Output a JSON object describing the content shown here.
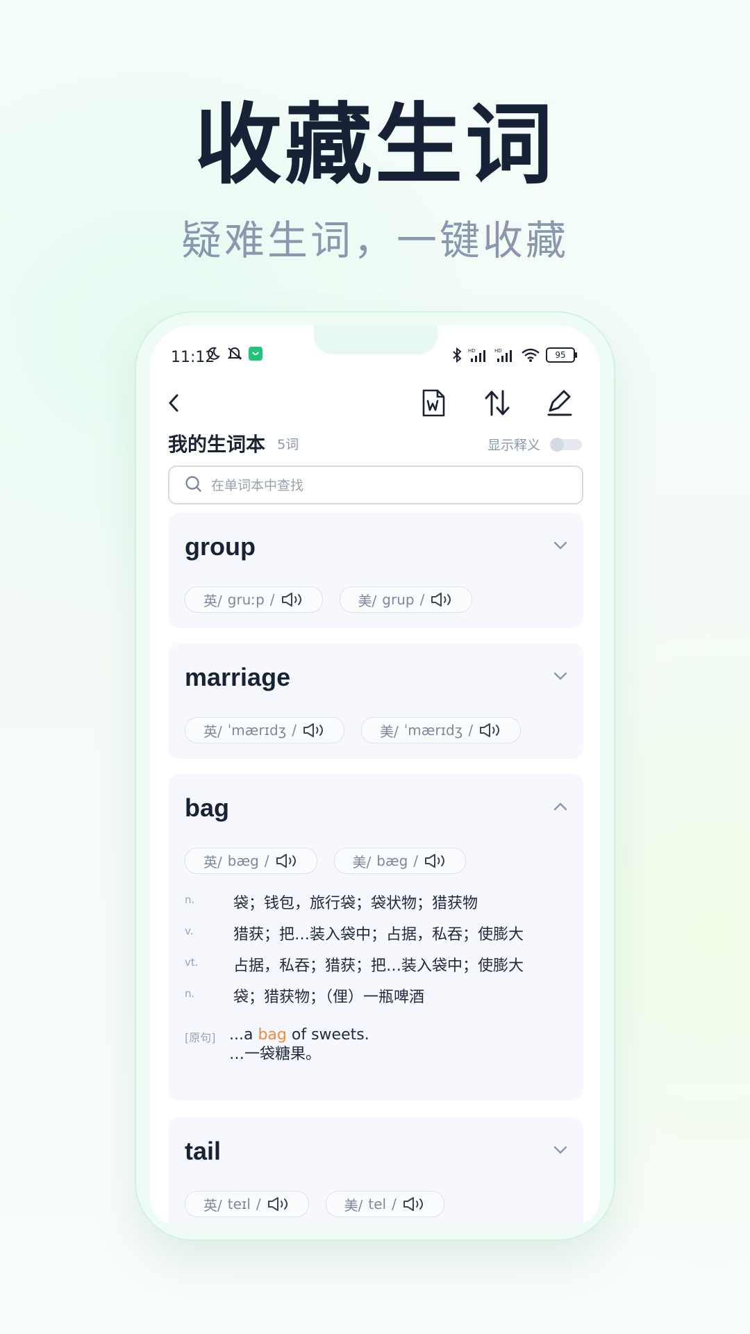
{
  "hero": {
    "title": "收藏生词",
    "subtitle": "疑难生词，一键收藏"
  },
  "status": {
    "time": "11:12",
    "battery": "95"
  },
  "header": {
    "title": "我的生词本",
    "count": "5词",
    "toggle_label": "显示释义"
  },
  "search": {
    "placeholder": "在单词本中查找"
  },
  "words": [
    {
      "word": "group",
      "uk_label": "英/",
      "uk": "gruːp",
      "us_label": "美/",
      "us": "grup",
      "slash": "/"
    },
    {
      "word": "marriage",
      "uk_label": "英/",
      "uk": "ˈmærɪdʒ",
      "us_label": "美/",
      "us": "ˈmærɪdʒ",
      "slash": "/"
    },
    {
      "word": "bag",
      "uk_label": "英/",
      "uk": "bæg",
      "us_label": "美/",
      "us": "bæg",
      "slash": "/",
      "definitions": [
        {
          "pos": "n.",
          "meaning": "袋；钱包，旅行袋；袋状物；猎获物"
        },
        {
          "pos": "v.",
          "meaning": "猎获；把…装入袋中；占据，私吞；使膨大"
        },
        {
          "pos": "vt.",
          "meaning": "占据，私吞；猎获；把…装入袋中；使膨大"
        },
        {
          "pos": "n.",
          "meaning": "袋；猎获物；（俚）一瓶啤酒"
        }
      ],
      "example": {
        "tag": "[原句]",
        "en_before": "...a ",
        "en_highlight": "bag",
        "en_after": " of sweets.",
        "cn": "…一袋糖果。"
      }
    },
    {
      "word": "tail",
      "uk_label": "英/",
      "uk": "teɪl",
      "us_label": "美/",
      "us": "tel",
      "slash": "/"
    }
  ],
  "colors": {
    "title": "#172236",
    "subtitle": "#8a97ae",
    "highlight": "#f08a3c",
    "card_bg": "#f7f8fd",
    "accent_green": "#22c37a"
  },
  "icons": {
    "back": "chevron-left-icon",
    "word_export": "word-doc-icon",
    "sort": "sort-arrows-icon",
    "edit": "pencil-icon",
    "search": "search-icon",
    "speaker": "speaker-icon"
  }
}
